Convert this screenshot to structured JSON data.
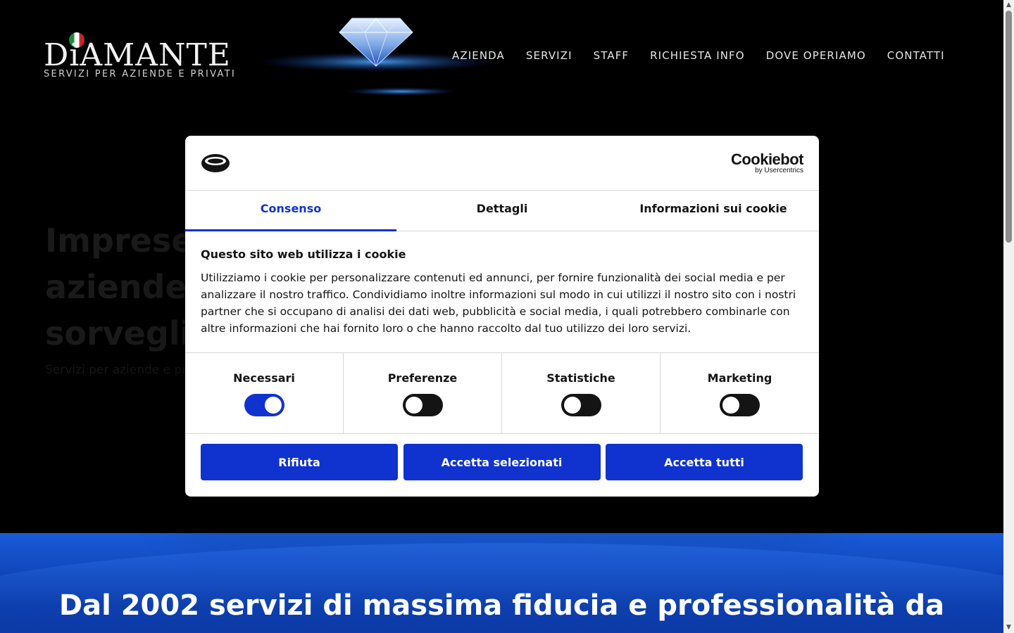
{
  "header": {
    "logo": {
      "wordmark": "DiAMANTE",
      "tagline": "SERVIZI PER AZIENDE E PRIVATI"
    },
    "nav": [
      {
        "label": "AZIENDA"
      },
      {
        "label": "SERVIZI"
      },
      {
        "label": "STAFF"
      },
      {
        "label": "RICHIESTA INFO"
      },
      {
        "label": "DOVE OPERIAMO"
      },
      {
        "label": "CONTATTI"
      }
    ]
  },
  "hero": {
    "title": "Imprese di pulizie, aziende di sorveglianza e servizi",
    "subtitle": "Servizi per aziende e privati"
  },
  "band": {
    "text": "Dal 2002 servizi di massima fiducia e professionalità da"
  },
  "cookie_dialog": {
    "brand": {
      "name": "Cookiebot",
      "by": "by Usercentrics"
    },
    "tabs": [
      {
        "label": "Consenso",
        "active": true
      },
      {
        "label": "Dettagli",
        "active": false
      },
      {
        "label": "Informazioni sui cookie",
        "active": false
      }
    ],
    "title": "Questo sito web utilizza i cookie",
    "body": "Utilizziamo i cookie per personalizzare contenuti ed annunci, per fornire funzionalità dei social media e per analizzare il nostro traffico. Condividiamo inoltre informazioni sul modo in cui utilizzi il nostro sito con i nostri partner che si occupano di analisi dei dati web, pubblicità e social media, i quali potrebbero combinarle con altre informazioni che hai fornito loro o che hanno raccolto dal tuo utilizzo dei loro servizi.",
    "toggles": [
      {
        "label": "Necessari",
        "checked": true
      },
      {
        "label": "Preferenze",
        "checked": false
      },
      {
        "label": "Statistiche",
        "checked": false
      },
      {
        "label": "Marketing",
        "checked": false
      }
    ],
    "buttons": {
      "reject": "Rifiuta",
      "accept_selected": "Accetta selezionati",
      "accept_all": "Accetta tutti"
    }
  },
  "colors": {
    "accent": "#1032cf",
    "band_blue": "#0f44b8",
    "page_bg": "#000000"
  }
}
